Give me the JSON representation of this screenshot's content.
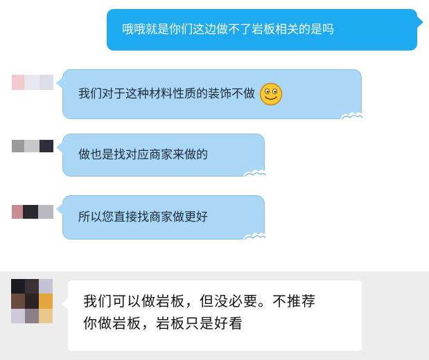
{
  "messages": [
    {
      "id": "m1",
      "direction": "outgoing",
      "text": "哦哦就是你们这边做不了岩板相关的是吗"
    },
    {
      "id": "m2",
      "direction": "incoming",
      "text": "我们对于这种材料性质的装饰不做",
      "emoji": "smiley-face"
    },
    {
      "id": "m3",
      "direction": "incoming",
      "text": "做也是找对应商家来做的"
    },
    {
      "id": "m4",
      "direction": "incoming",
      "text": "所以您直接找商家做更好"
    },
    {
      "id": "m5",
      "direction": "incoming",
      "lines": [
        "我们可以做岩板，但没必要。不推荐",
        "你做岩板，岩板只是好看"
      ]
    }
  ],
  "colors": {
    "outgoing_bubble": "#1eaaf1",
    "incoming_bubble": "#a9d7f5",
    "quoted_panel_bg": "#ededed"
  }
}
